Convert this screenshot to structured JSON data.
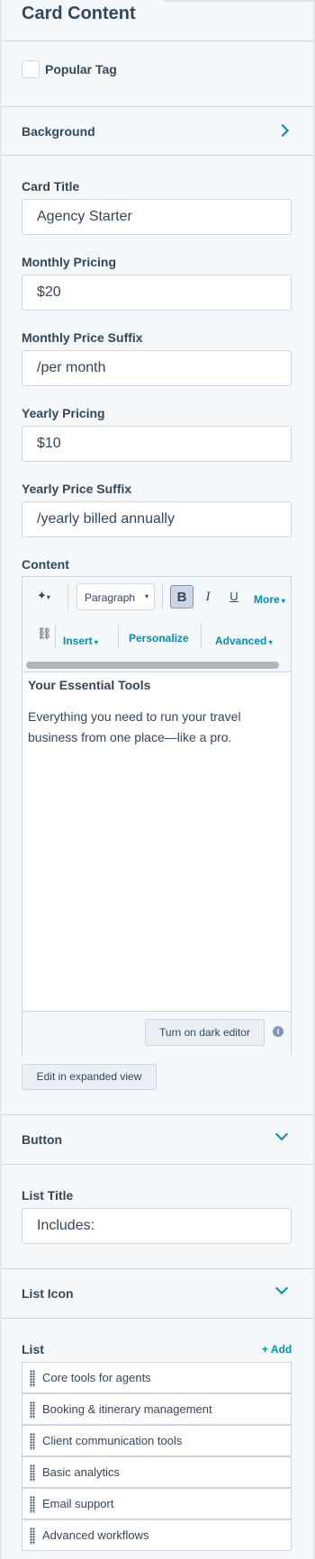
{
  "panel": {
    "title": "Card Content"
  },
  "popular_tag": {
    "label": "Popular Tag",
    "checked": false
  },
  "background_section": {
    "label": "Background",
    "icon": "chevron-right-icon"
  },
  "fields": {
    "card_title": {
      "label": "Card Title",
      "value": "Agency Starter"
    },
    "monthly_pricing": {
      "label": "Monthly Pricing",
      "value": "$20"
    },
    "monthly_suffix": {
      "label": "Monthly Price Suffix",
      "value": "/per month"
    },
    "yearly_pricing": {
      "label": "Yearly Pricing",
      "value": "$10"
    },
    "yearly_suffix": {
      "label": "Yearly Price Suffix",
      "value": "/yearly billed annually"
    }
  },
  "content": {
    "label": "Content",
    "toolbar": {
      "sparkle_icon": "sparkle-icon",
      "paragraph": "Paragraph",
      "bold": "B",
      "italic": "I",
      "underline": "U",
      "more": "More",
      "link_icon": "link-icon",
      "insert": "Insert",
      "personalize": "Personalize",
      "advanced": "Advanced"
    },
    "heading": "Your Essential Tools",
    "body": "Everything you need to run your travel business from one place—like a pro.",
    "dark_editor": "Turn on dark editor",
    "info_icon": "info-icon",
    "expanded_view": "Edit in expanded view"
  },
  "button_section": {
    "label": "Button",
    "icon": "chevron-down-icon"
  },
  "list_title": {
    "label": "List Title",
    "value": "Includes:"
  },
  "list_icon_section": {
    "label": "List Icon",
    "icon": "chevron-down-icon"
  },
  "list": {
    "label": "List",
    "add": "+ Add",
    "items": [
      "Core tools for agents",
      "Booking & itinerary management",
      "Client communication tools",
      "Basic analytics",
      "Email support",
      "Advanced workflows"
    ]
  },
  "colors": {
    "accent": "#0091ae",
    "text": "#33475b",
    "border": "#cbd6e2",
    "background": "#f5f8fa"
  }
}
